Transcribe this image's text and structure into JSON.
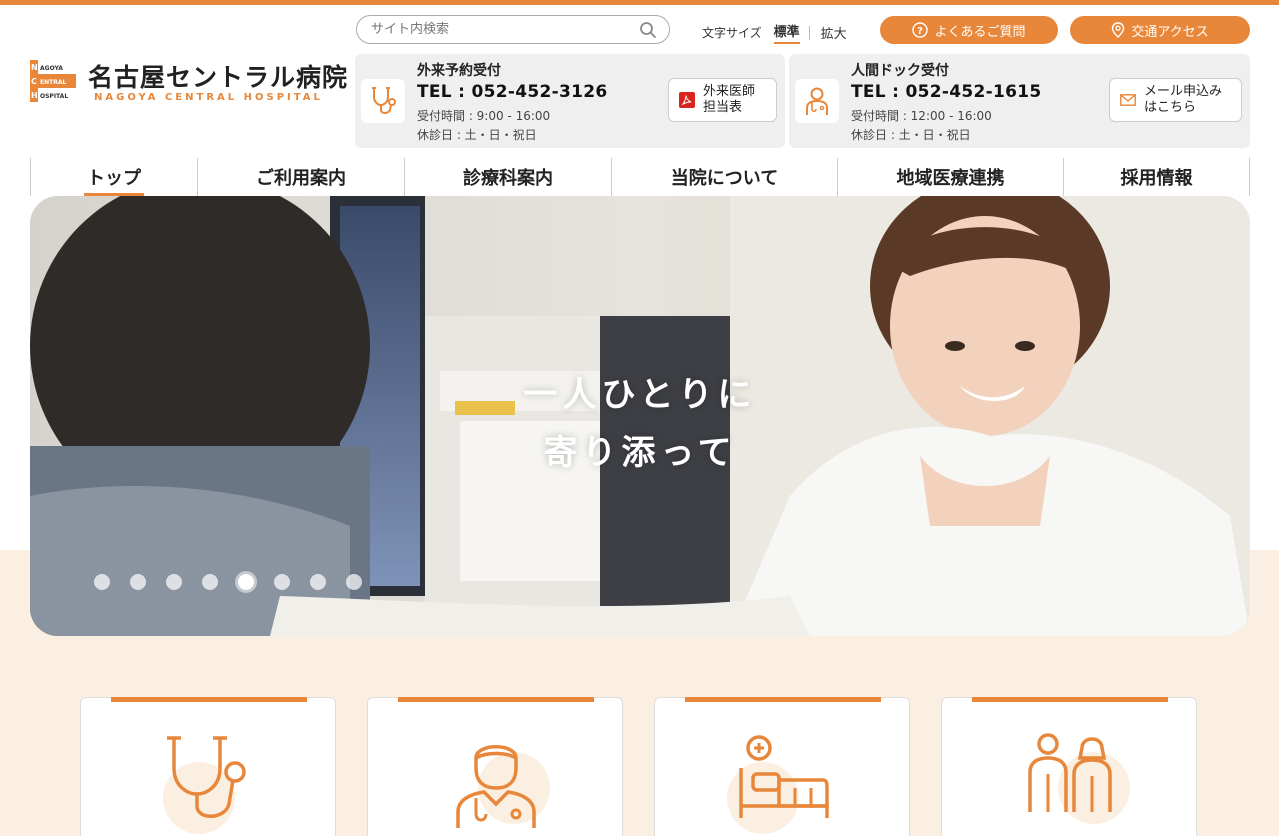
{
  "header": {
    "logo": {
      "name_jp": "名古屋セントラル病院",
      "name_en": "NAGOYA CENTRAL HOSPITAL",
      "mark_text": [
        "NAGOYA",
        "CENTRAL",
        "HOSPITAL"
      ]
    },
    "search": {
      "placeholder": "サイト内検索"
    },
    "font_size": {
      "label": "文字サイズ",
      "standard": "標準",
      "large": "拡大"
    },
    "faq_label": "よくあるご質問",
    "access_label": "交通アクセス"
  },
  "info": {
    "outpatient": {
      "title": "外来予約受付",
      "tel": "TEL : 052-452-3126",
      "hours": "受付時間 : 9:00 - 16:00",
      "closed": "休診日 : 土・日・祝日",
      "button_line1": "外来医師",
      "button_line2": "担当表"
    },
    "dock": {
      "title": "人間ドック受付",
      "tel": "TEL : 052-452-1615",
      "hours": "受付時間 : 12:00 - 16:00",
      "closed": "休診日 : 土・日・祝日",
      "button_line1": "メール申込み",
      "button_line2": "はこちら"
    }
  },
  "nav": [
    {
      "label": "トップ",
      "active": true
    },
    {
      "label": "ご利用案内"
    },
    {
      "label": "診療科案内"
    },
    {
      "label": "当院について"
    },
    {
      "label": "地域医療連携"
    },
    {
      "label": "採用情報"
    }
  ],
  "hero": {
    "caption_line1": "一人ひとりに",
    "caption_line2": "寄り添って",
    "slide_count": 8,
    "active_slide": 5
  },
  "cards": [
    {
      "icon": "stethoscope-icon"
    },
    {
      "icon": "doctor-icon"
    },
    {
      "icon": "hospital-bed-icon"
    },
    {
      "icon": "couple-icon"
    }
  ],
  "colors": {
    "accent": "#e8873a",
    "accent_light": "#fbefe2",
    "info_bg": "#efefef"
  }
}
